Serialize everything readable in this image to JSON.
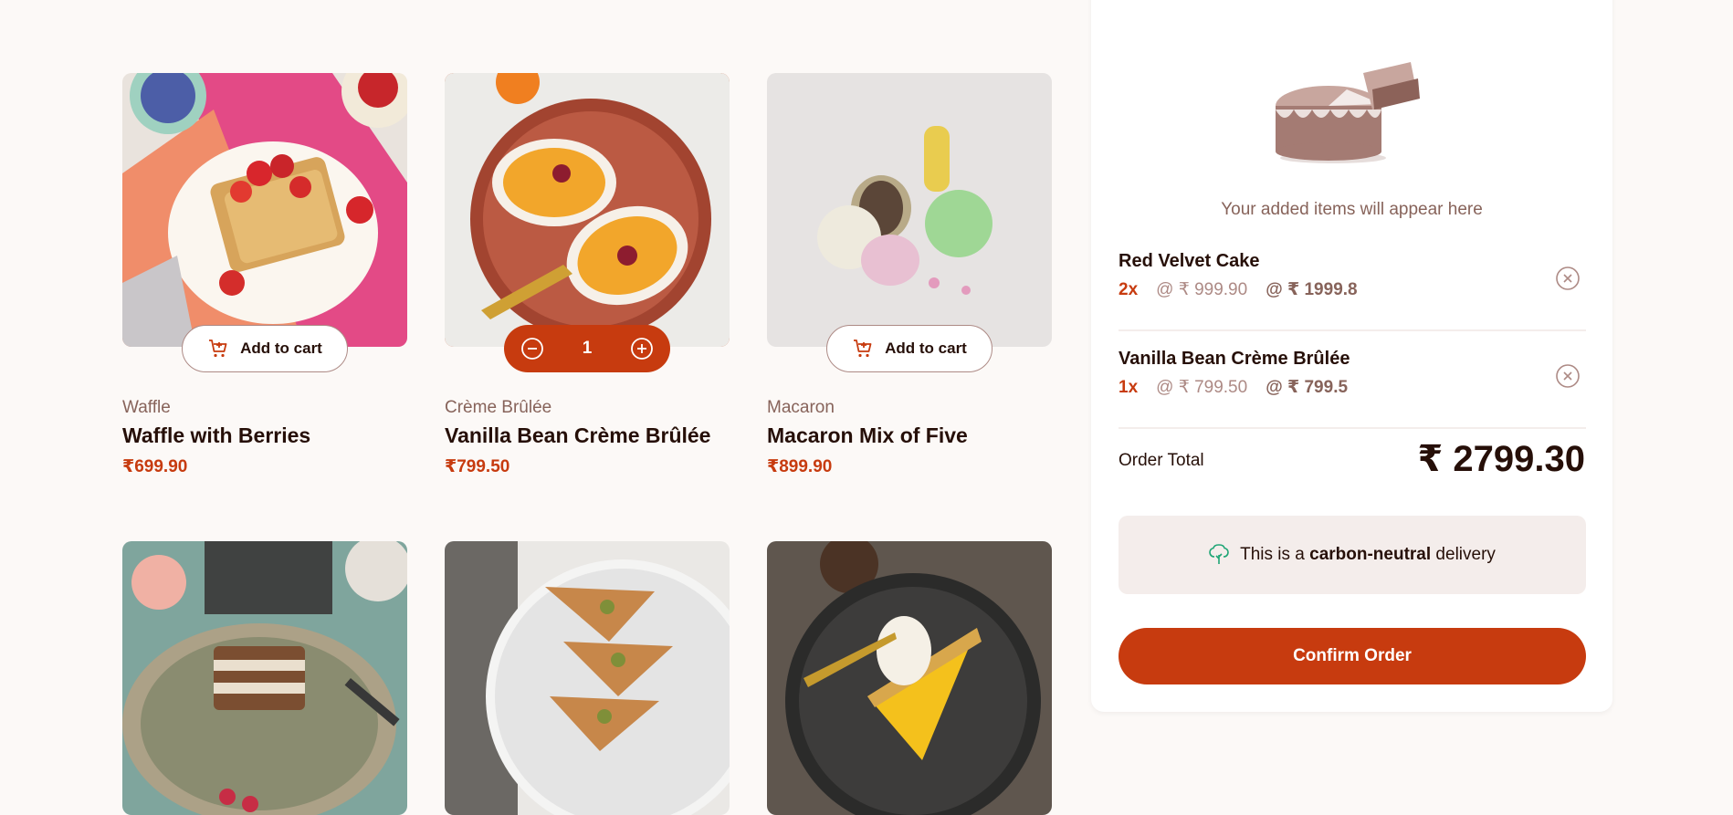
{
  "products": [
    {
      "category": "Waffle",
      "name": "Waffle with Berries",
      "price": "₹699.90",
      "button": "Add to cart"
    },
    {
      "category": "Crème Brûlée",
      "name": "Vanilla Bean Crème Brûlée",
      "price": "₹799.50",
      "quantity": "1"
    },
    {
      "category": "Macaron",
      "name": "Macaron Mix of Five",
      "price": "₹899.90",
      "button": "Add to cart"
    }
  ],
  "cart": {
    "empty_text": "Your added items will appear here",
    "items": [
      {
        "name": "Red Velvet Cake",
        "qty": "2x",
        "unit": "@ ₹ 999.90",
        "total": "@ ₹ 1999.8"
      },
      {
        "name": "Vanilla Bean Crème Brûlée",
        "qty": "1x",
        "unit": "@ ₹ 799.50",
        "total": "@ ₹ 799.5"
      }
    ],
    "total_label": "Order Total",
    "total_value": "₹ 2799.30",
    "carbon_prefix": "This is a ",
    "carbon_bold": "carbon-neutral",
    "carbon_suffix": " delivery",
    "confirm_label": "Confirm Order"
  },
  "icons": {
    "add": "add-to-cart-icon",
    "decrement": "minus-circle-icon",
    "increment": "plus-circle-icon",
    "remove": "remove-circle-icon",
    "carbon": "tree-icon"
  },
  "colors": {
    "accent": "#c73b0f",
    "muted": "#87635a",
    "light": "#ad8a85",
    "bg": "#fcf9f7",
    "panel": "#f4edeb"
  }
}
